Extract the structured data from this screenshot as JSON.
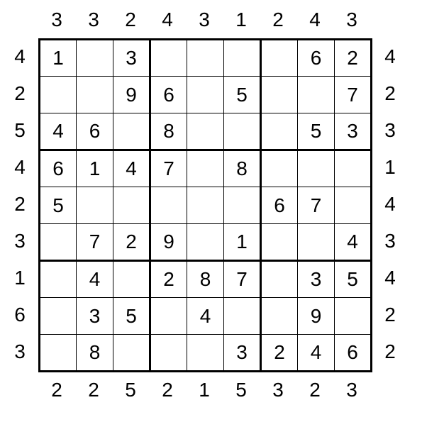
{
  "clues": {
    "top": [
      "3",
      "3",
      "2",
      "4",
      "3",
      "1",
      "2",
      "4",
      "3"
    ],
    "bottom": [
      "2",
      "2",
      "5",
      "2",
      "1",
      "5",
      "3",
      "2",
      "3"
    ],
    "left": [
      "4",
      "2",
      "5",
      "4",
      "2",
      "3",
      "1",
      "6",
      "3"
    ],
    "right": [
      "4",
      "2",
      "3",
      "1",
      "4",
      "3",
      "4",
      "2",
      "2"
    ]
  },
  "grid": [
    [
      "1",
      "",
      "3",
      "",
      "",
      "",
      "",
      "6",
      "2"
    ],
    [
      "",
      "",
      "9",
      "6",
      "",
      "5",
      "",
      "",
      "7"
    ],
    [
      "4",
      "6",
      "",
      "8",
      "",
      "",
      "",
      "5",
      "3"
    ],
    [
      "6",
      "1",
      "4",
      "7",
      "",
      "8",
      "",
      "",
      ""
    ],
    [
      "5",
      "",
      "",
      "",
      "",
      "",
      "6",
      "7",
      ""
    ],
    [
      "",
      "7",
      "2",
      "9",
      "",
      "1",
      "",
      "",
      "4"
    ],
    [
      "",
      "4",
      "",
      "2",
      "8",
      "7",
      "",
      "3",
      "5"
    ],
    [
      "",
      "3",
      "5",
      "",
      "4",
      "",
      "",
      "9",
      ""
    ],
    [
      "",
      "8",
      "",
      "",
      "",
      "3",
      "2",
      "4",
      "6"
    ]
  ]
}
